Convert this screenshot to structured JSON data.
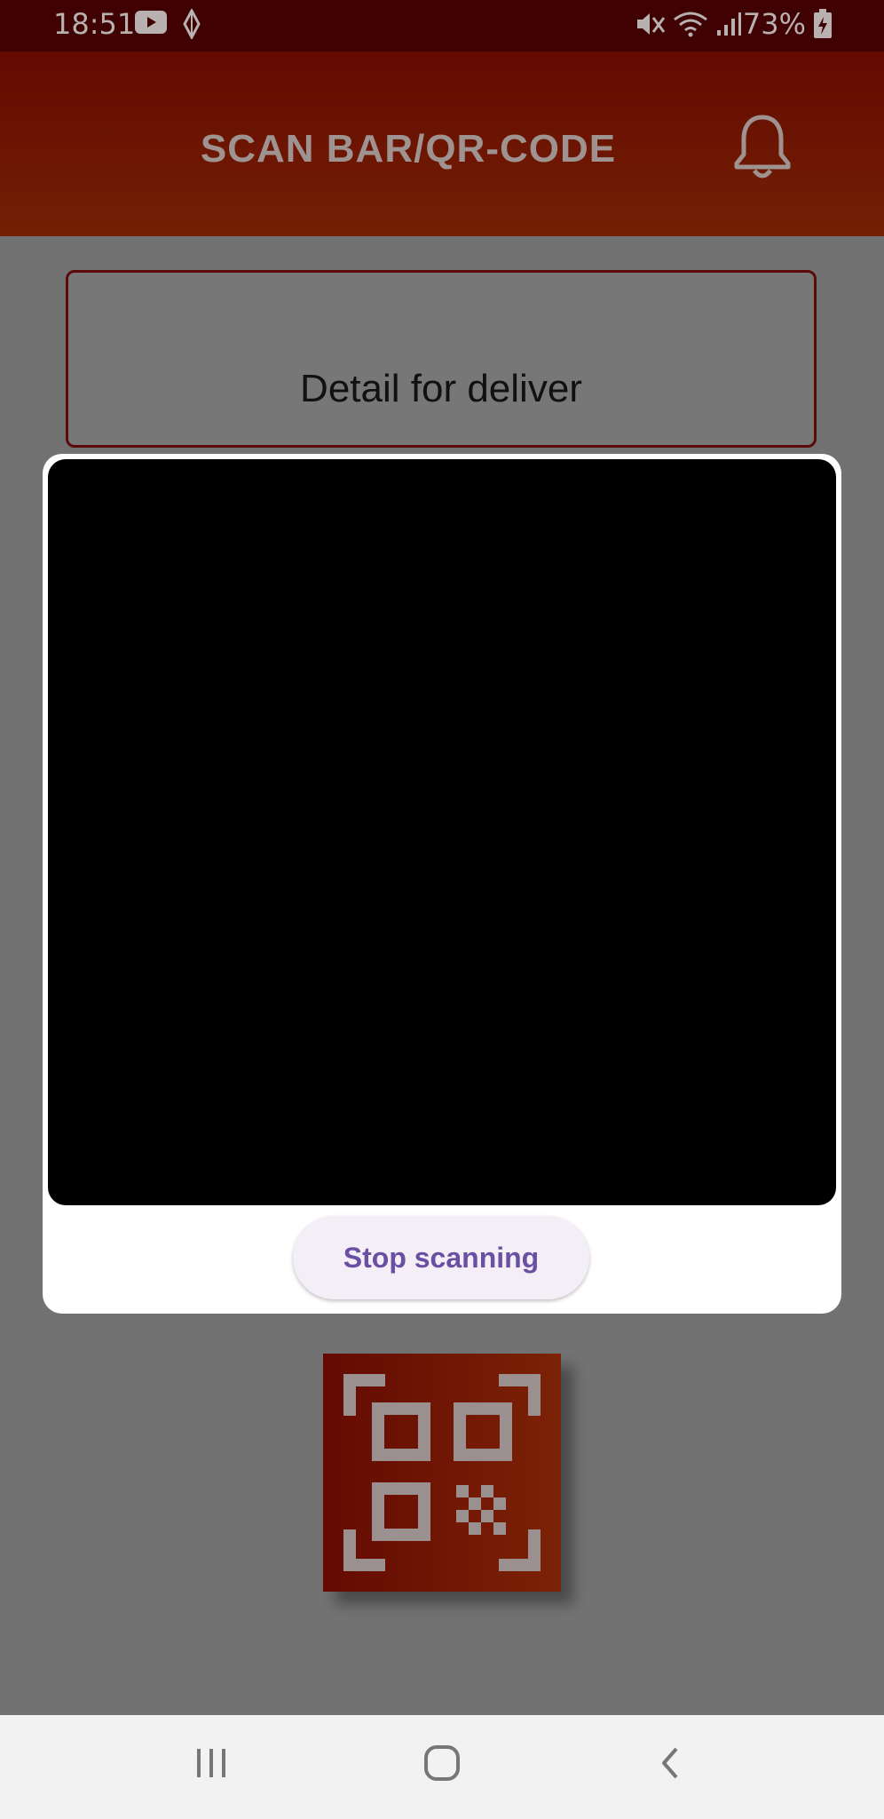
{
  "status_bar": {
    "time": "18:51",
    "battery": "73%",
    "icons": [
      "youtube-icon",
      "app-notification-icon",
      "mute-icon",
      "wifi-icon",
      "signal-icon",
      "battery-charging-icon"
    ]
  },
  "header": {
    "title": "SCAN BAR/QR-CODE",
    "icon": "bell-icon"
  },
  "detail_card": {
    "title": "Detail for deliver"
  },
  "scanner_dialog": {
    "stop_label": "Stop scanning"
  },
  "qr_graphic": {
    "icon": "qr-code-icon"
  },
  "nav_bar": {
    "icons": [
      "recent-apps-icon",
      "home-icon",
      "back-icon"
    ]
  },
  "colors": {
    "header_gradient_start": "#640a02",
    "header_gradient_end": "#732004",
    "status_bar": "#3f0102",
    "overlay_background": "#727272",
    "button_text": "#6a4fa2",
    "button_bg": "#f4eff6"
  }
}
